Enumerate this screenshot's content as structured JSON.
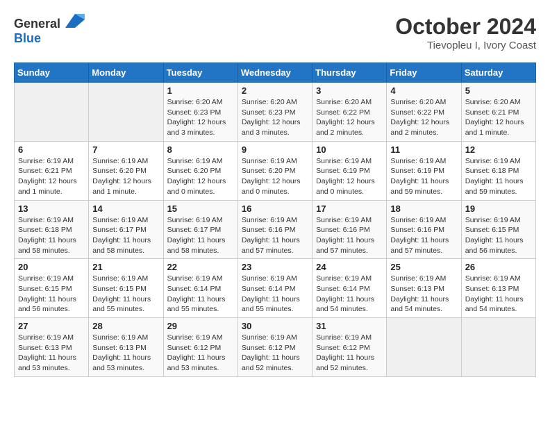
{
  "header": {
    "logo_general": "General",
    "logo_blue": "Blue",
    "title": "October 2024",
    "subtitle": "Tievopleu I, Ivory Coast"
  },
  "calendar": {
    "weekdays": [
      "Sunday",
      "Monday",
      "Tuesday",
      "Wednesday",
      "Thursday",
      "Friday",
      "Saturday"
    ],
    "weeks": [
      [
        {
          "day": "",
          "info": ""
        },
        {
          "day": "",
          "info": ""
        },
        {
          "day": "1",
          "info": "Sunrise: 6:20 AM\nSunset: 6:23 PM\nDaylight: 12 hours and 3 minutes."
        },
        {
          "day": "2",
          "info": "Sunrise: 6:20 AM\nSunset: 6:23 PM\nDaylight: 12 hours and 3 minutes."
        },
        {
          "day": "3",
          "info": "Sunrise: 6:20 AM\nSunset: 6:22 PM\nDaylight: 12 hours and 2 minutes."
        },
        {
          "day": "4",
          "info": "Sunrise: 6:20 AM\nSunset: 6:22 PM\nDaylight: 12 hours and 2 minutes."
        },
        {
          "day": "5",
          "info": "Sunrise: 6:20 AM\nSunset: 6:21 PM\nDaylight: 12 hours and 1 minute."
        }
      ],
      [
        {
          "day": "6",
          "info": "Sunrise: 6:19 AM\nSunset: 6:21 PM\nDaylight: 12 hours and 1 minute."
        },
        {
          "day": "7",
          "info": "Sunrise: 6:19 AM\nSunset: 6:20 PM\nDaylight: 12 hours and 1 minute."
        },
        {
          "day": "8",
          "info": "Sunrise: 6:19 AM\nSunset: 6:20 PM\nDaylight: 12 hours and 0 minutes."
        },
        {
          "day": "9",
          "info": "Sunrise: 6:19 AM\nSunset: 6:20 PM\nDaylight: 12 hours and 0 minutes."
        },
        {
          "day": "10",
          "info": "Sunrise: 6:19 AM\nSunset: 6:19 PM\nDaylight: 12 hours and 0 minutes."
        },
        {
          "day": "11",
          "info": "Sunrise: 6:19 AM\nSunset: 6:19 PM\nDaylight: 11 hours and 59 minutes."
        },
        {
          "day": "12",
          "info": "Sunrise: 6:19 AM\nSunset: 6:18 PM\nDaylight: 11 hours and 59 minutes."
        }
      ],
      [
        {
          "day": "13",
          "info": "Sunrise: 6:19 AM\nSunset: 6:18 PM\nDaylight: 11 hours and 58 minutes."
        },
        {
          "day": "14",
          "info": "Sunrise: 6:19 AM\nSunset: 6:17 PM\nDaylight: 11 hours and 58 minutes."
        },
        {
          "day": "15",
          "info": "Sunrise: 6:19 AM\nSunset: 6:17 PM\nDaylight: 11 hours and 58 minutes."
        },
        {
          "day": "16",
          "info": "Sunrise: 6:19 AM\nSunset: 6:16 PM\nDaylight: 11 hours and 57 minutes."
        },
        {
          "day": "17",
          "info": "Sunrise: 6:19 AM\nSunset: 6:16 PM\nDaylight: 11 hours and 57 minutes."
        },
        {
          "day": "18",
          "info": "Sunrise: 6:19 AM\nSunset: 6:16 PM\nDaylight: 11 hours and 57 minutes."
        },
        {
          "day": "19",
          "info": "Sunrise: 6:19 AM\nSunset: 6:15 PM\nDaylight: 11 hours and 56 minutes."
        }
      ],
      [
        {
          "day": "20",
          "info": "Sunrise: 6:19 AM\nSunset: 6:15 PM\nDaylight: 11 hours and 56 minutes."
        },
        {
          "day": "21",
          "info": "Sunrise: 6:19 AM\nSunset: 6:15 PM\nDaylight: 11 hours and 55 minutes."
        },
        {
          "day": "22",
          "info": "Sunrise: 6:19 AM\nSunset: 6:14 PM\nDaylight: 11 hours and 55 minutes."
        },
        {
          "day": "23",
          "info": "Sunrise: 6:19 AM\nSunset: 6:14 PM\nDaylight: 11 hours and 55 minutes."
        },
        {
          "day": "24",
          "info": "Sunrise: 6:19 AM\nSunset: 6:14 PM\nDaylight: 11 hours and 54 minutes."
        },
        {
          "day": "25",
          "info": "Sunrise: 6:19 AM\nSunset: 6:13 PM\nDaylight: 11 hours and 54 minutes."
        },
        {
          "day": "26",
          "info": "Sunrise: 6:19 AM\nSunset: 6:13 PM\nDaylight: 11 hours and 54 minutes."
        }
      ],
      [
        {
          "day": "27",
          "info": "Sunrise: 6:19 AM\nSunset: 6:13 PM\nDaylight: 11 hours and 53 minutes."
        },
        {
          "day": "28",
          "info": "Sunrise: 6:19 AM\nSunset: 6:13 PM\nDaylight: 11 hours and 53 minutes."
        },
        {
          "day": "29",
          "info": "Sunrise: 6:19 AM\nSunset: 6:12 PM\nDaylight: 11 hours and 53 minutes."
        },
        {
          "day": "30",
          "info": "Sunrise: 6:19 AM\nSunset: 6:12 PM\nDaylight: 11 hours and 52 minutes."
        },
        {
          "day": "31",
          "info": "Sunrise: 6:19 AM\nSunset: 6:12 PM\nDaylight: 11 hours and 52 minutes."
        },
        {
          "day": "",
          "info": ""
        },
        {
          "day": "",
          "info": ""
        }
      ]
    ]
  }
}
